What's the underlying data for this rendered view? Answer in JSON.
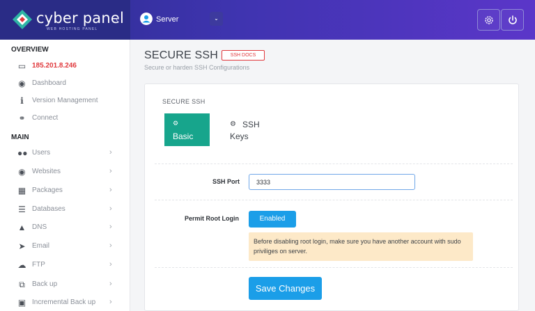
{
  "brand": {
    "name": "cyber panel",
    "tagline": "WEB HOSTING PANEL"
  },
  "topbar": {
    "server_label": "Server",
    "collapse_icon": "chevron-left-icon",
    "settings_icon": "gear-icon",
    "power_icon": "power-icon"
  },
  "sidebar": {
    "overview_title": "OVERVIEW",
    "ip": "185.201.8.246",
    "overview_items": [
      {
        "label": "Dashboard",
        "icon": "palette-icon"
      },
      {
        "label": "Version Management",
        "icon": "info-icon"
      },
      {
        "label": "Connect",
        "icon": "link-icon"
      }
    ],
    "main_title": "MAIN",
    "main_items": [
      {
        "label": "Users",
        "icon": "users-icon"
      },
      {
        "label": "Websites",
        "icon": "globe-icon"
      },
      {
        "label": "Packages",
        "icon": "cubes-icon"
      },
      {
        "label": "Databases",
        "icon": "database-icon"
      },
      {
        "label": "DNS",
        "icon": "sitemap-icon"
      },
      {
        "label": "Email",
        "icon": "paper-plane-icon"
      },
      {
        "label": "FTP",
        "icon": "cloud-upload-icon"
      },
      {
        "label": "Back up",
        "icon": "copy-icon"
      },
      {
        "label": "Incremental Back up",
        "icon": "save-icon"
      }
    ]
  },
  "main": {
    "title": "SECURE SSH -",
    "docs_badge": "SSH DOCS",
    "subtitle": "Secure or harden SSH Configurations",
    "card_title": "SECURE SSH",
    "tabs": [
      {
        "label": "Basic",
        "icon": "gear-icon",
        "active": true
      },
      {
        "label_line1": "SSH",
        "label_line2": "Keys",
        "icon": "gears-icon",
        "active": false
      }
    ],
    "ssh_port_label": "SSH Port",
    "ssh_port_value": "3333",
    "permit_root_label": "Permit Root Login",
    "permit_root_value": "Enabled",
    "warning": "Before disabling root login, make sure you have another account with sudo priviliges on server.",
    "save_button": "Save Changes"
  },
  "colors": {
    "accent": "#1b9ee8",
    "tab_active": "#17a58c",
    "danger": "#e0383c",
    "topbar": "#3f34b0",
    "warning_bg": "#fde9c8"
  }
}
